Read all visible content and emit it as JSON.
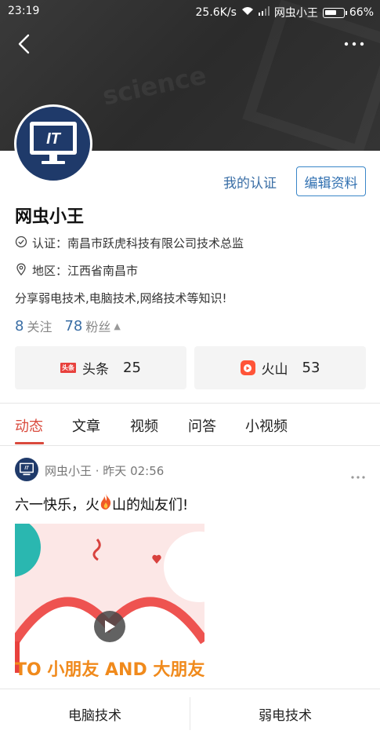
{
  "status_bar": {
    "time": "23:19",
    "network_speed": "25.6K/s",
    "carrier": "网虫小王",
    "battery": "66%"
  },
  "header": {
    "back_icon": "chevron-left-icon",
    "more_icon": "more-dots-icon"
  },
  "profile": {
    "avatar_text": "IT",
    "my_cert_label": "我的认证",
    "edit_label": "编辑资料",
    "name": "网虫小王",
    "certification": "认证：南昌市跃虎科技有限公司技术总监",
    "region": "地区：江西省南昌市",
    "bio": "分享弱电技术,电脑技术,网络技术等知识!",
    "following_count": "8",
    "following_label": "关注",
    "followers_count": "78",
    "followers_label": "粉丝"
  },
  "platforms": [
    {
      "logo_text": "头条",
      "label": "头条",
      "count": "25"
    },
    {
      "label": "火山",
      "count": "53"
    }
  ],
  "tabs": [
    {
      "label": "动态",
      "active": true
    },
    {
      "label": "文章",
      "active": false
    },
    {
      "label": "视频",
      "active": false
    },
    {
      "label": "问答",
      "active": false
    },
    {
      "label": "小视频",
      "active": false
    }
  ],
  "post": {
    "author": "网虫小王",
    "meta": "网虫小王 · 昨天 02:56",
    "text_before": "六一快乐，火",
    "text_after": "山的灿友们!",
    "image_caption": "TO 小朋友 AND 大朋友"
  },
  "bottom_bar": {
    "item1": "电脑技术",
    "item2": "弱电技术"
  },
  "colors": {
    "accent_red": "#d94a3d",
    "link_blue": "#3a6ea5",
    "header_dark": "#333333"
  }
}
